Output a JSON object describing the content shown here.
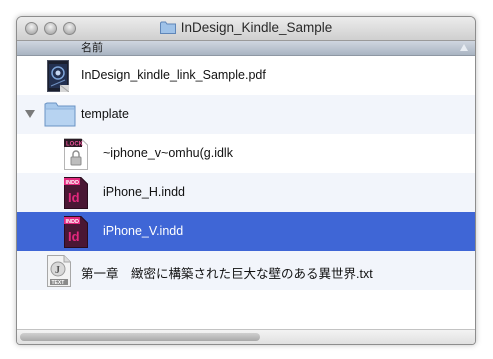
{
  "window": {
    "title": "InDesign_Kindle_Sample"
  },
  "column_header": {
    "name_label": "名前"
  },
  "rows": [
    {
      "label": "InDesign_kindle_link_Sample.pdf"
    },
    {
      "label": "template"
    },
    {
      "label": "~iphone_v~omhu(g.idlk",
      "badge": "LOCK"
    },
    {
      "label": "iPhone_H.indd",
      "badge": "INDD",
      "glyph": "Id"
    },
    {
      "label": "iPhone_V.indd",
      "badge": "INDD",
      "glyph": "Id"
    },
    {
      "label": "第一章　緻密に構築された巨大な壁のある異世界.txt",
      "badge": "TEXT",
      "glyph": "J"
    }
  ],
  "colors": {
    "selection": "#3f66d6",
    "alt_row": "#f2f5fb",
    "indesign_pink": "#e2287d",
    "indesign_dark": "#4a1734"
  }
}
